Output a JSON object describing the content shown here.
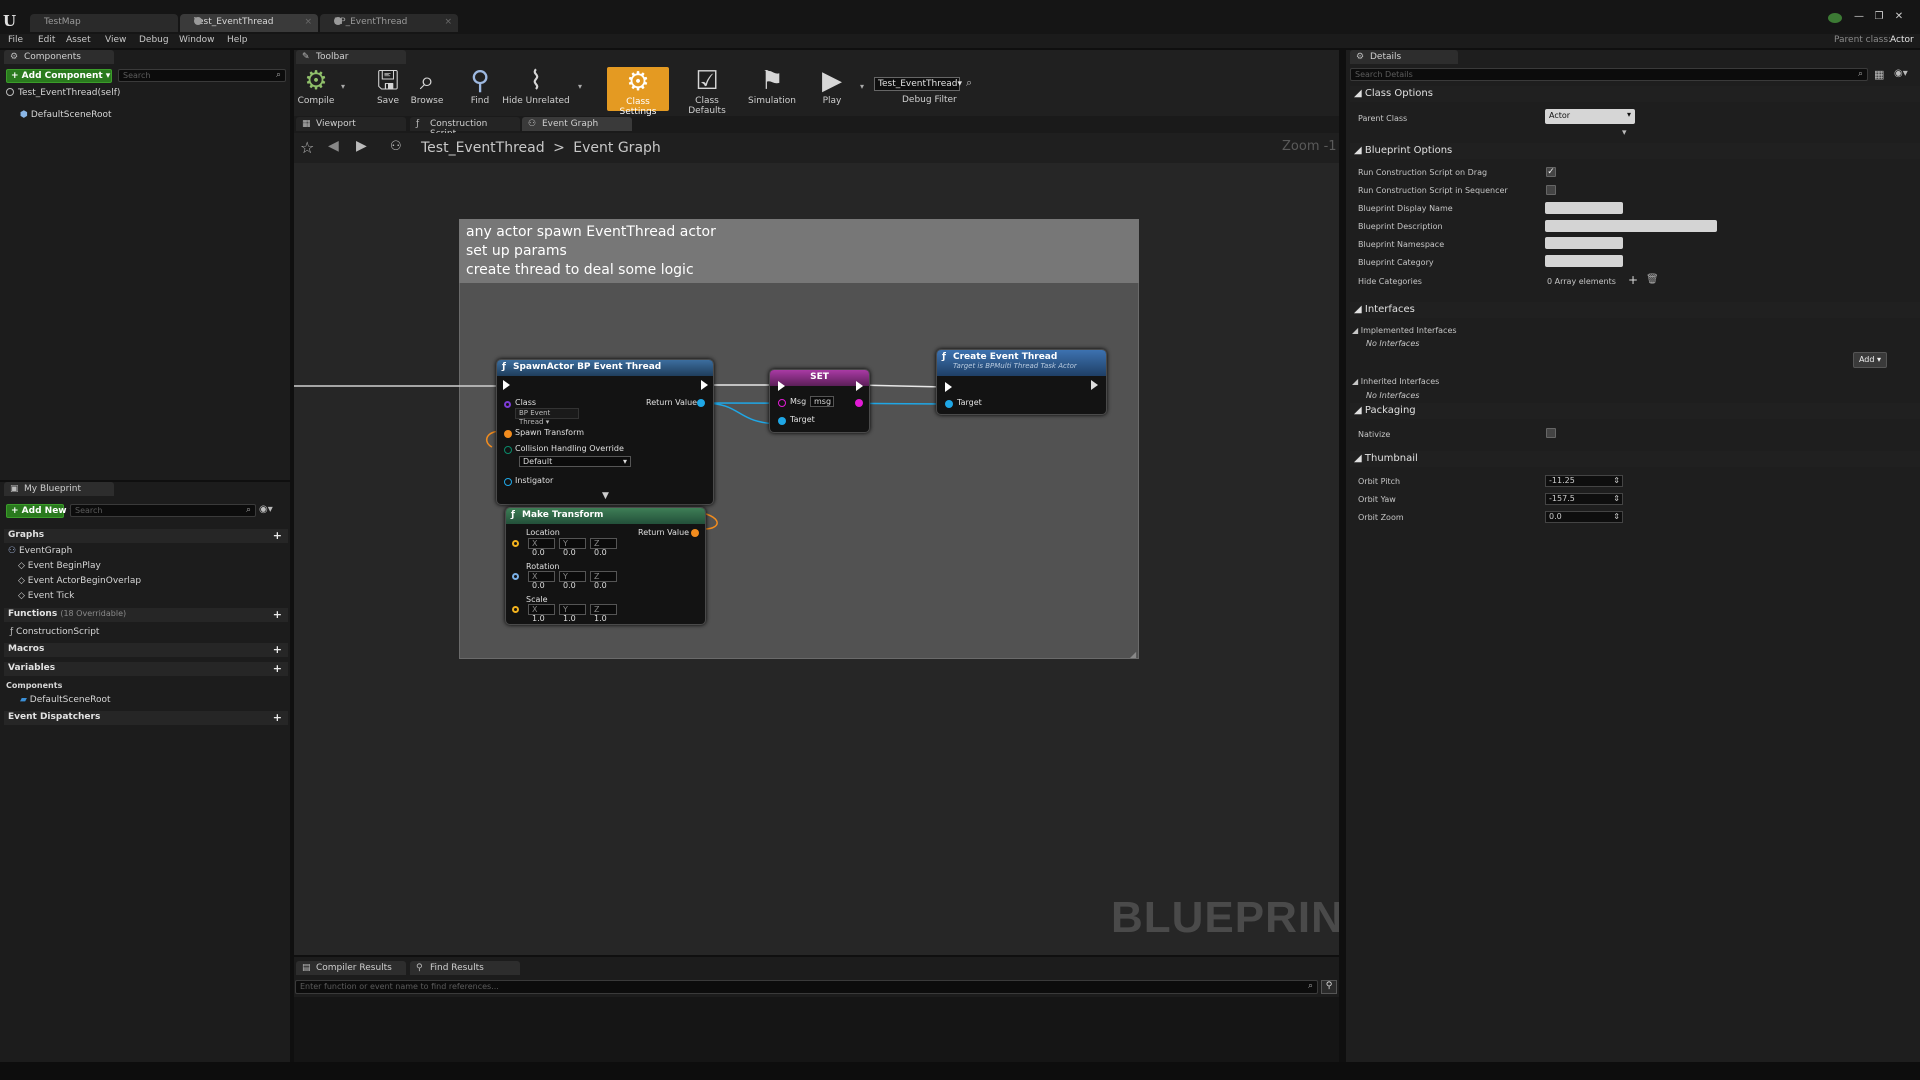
{
  "tabs": [
    {
      "label": "TestMap",
      "active": false
    },
    {
      "label": "Test_EventThread",
      "active": true
    },
    {
      "label": "BP_EventThread",
      "active": false
    }
  ],
  "menu": [
    "File",
    "Edit",
    "Asset",
    "View",
    "Debug",
    "Window",
    "Help"
  ],
  "parent_class": {
    "label": "Parent class:",
    "value": "Actor"
  },
  "components_panel": {
    "tab": "Components",
    "add_component": "+ Add Component ▾",
    "search_placeholder": "Search",
    "root": "Test_EventThread(self)",
    "child": "DefaultSceneRoot"
  },
  "toolbar": {
    "tab": "Toolbar",
    "compile": "Compile",
    "save": "Save",
    "browse": "Browse",
    "find": "Find",
    "hide_unrelated": "Hide Unrelated",
    "class_settings": "Class Settings",
    "class_defaults": "Class Defaults",
    "simulation": "Simulation",
    "play": "Play",
    "debug_object": "Test_EventThread▾",
    "debug_filter": "Debug Filter"
  },
  "editor_tabs": [
    "Viewport",
    "Construction Script",
    "Event Graph"
  ],
  "breadcrumb": {
    "root": "Test_EventThread",
    "sep": ">",
    "leaf": "Event Graph",
    "zoom": "Zoom -1"
  },
  "comment": {
    "lines": [
      "any actor spawn EventThread actor",
      "set up params",
      "create thread to deal some logic"
    ]
  },
  "nodes": {
    "spawn": {
      "title": "SpawnActor BP Event Thread",
      "class_label": "Class",
      "class_value": "BP Event Thread ▾",
      "return_value": "Return Value",
      "spawn_transform": "Spawn Transform",
      "collision": "Collision Handling Override",
      "collision_value": "Default",
      "instigator": "Instigator"
    },
    "make_transform": {
      "title": "Make Transform",
      "location": "Location",
      "rotation": "Rotation",
      "scale": "Scale",
      "return_value": "Return Value",
      "loc": [
        "0.0",
        "0.0",
        "0.0"
      ],
      "rot": [
        "0.0",
        "0.0",
        "0.0"
      ],
      "scl": [
        "1.0",
        "1.0",
        "1.0"
      ],
      "axes": [
        "X",
        "Y",
        "Z"
      ]
    },
    "set": {
      "title": "SET",
      "msg": "Msg",
      "msg_value": "msg",
      "target": "Target"
    },
    "create": {
      "title": "Create Event Thread",
      "subtitle": "Target is BPMulti Thread Task Actor",
      "target": "Target"
    }
  },
  "watermark": "BLUEPRINT",
  "my_blueprint": {
    "tab": "My Blueprint",
    "add_new": "+ Add New ▾",
    "search_placeholder": "Search",
    "graphs": "Graphs",
    "event_graph": "EventGraph",
    "events": [
      "Event BeginPlay",
      "Event ActorBeginOverlap",
      "Event Tick"
    ],
    "functions": "Functions",
    "functions_count": "(18 Overridable)",
    "construction_script": "ConstructionScript",
    "macros": "Macros",
    "variables": "Variables",
    "components": "Components",
    "default_scene_root": "DefaultSceneRoot",
    "event_dispatchers": "Event Dispatchers"
  },
  "bottom": {
    "compiler_results": "Compiler Results",
    "find_results": "Find Results",
    "find_placeholder": "Enter function or event name to find references..."
  },
  "details": {
    "tab": "Details",
    "search_placeholder": "Search Details",
    "class_options": "Class Options",
    "parent_class_label": "Parent Class",
    "parent_class_value": "Actor",
    "blueprint_options": "Blueprint Options",
    "rows": [
      "Run Construction Script on Drag",
      "Run Construction Script in Sequencer",
      "Blueprint Display Name",
      "Blueprint Description",
      "Blueprint Namespace",
      "Blueprint Category",
      "Hide Categories"
    ],
    "array_elements": "0 Array elements",
    "interfaces": "Interfaces",
    "implemented_interfaces": "Implemented Interfaces",
    "no_interfaces_1": "No Interfaces",
    "add": "Add ▾",
    "inherited_interfaces": "Inherited Interfaces",
    "no_interfaces_2": "No Interfaces",
    "packaging": "Packaging",
    "nativize": "Nativize",
    "thumbnail": "Thumbnail",
    "orbit_pitch": "Orbit Pitch",
    "orbit_pitch_value": "-11.25",
    "orbit_yaw": "Orbit Yaw",
    "orbit_yaw_value": "-157.5",
    "orbit_zoom": "Orbit Zoom",
    "orbit_zoom_value": "0.0"
  },
  "colors": {
    "exec": "#ffffff",
    "object_pin": "#1fa7e6",
    "struct_pin": "#f28c1e",
    "string_pin": "#e21bd6",
    "spawn_header": "#2d5b8a",
    "set_header": "#8a2a86",
    "func_header": "#2a5590",
    "make_header": "#2d6b4a"
  }
}
